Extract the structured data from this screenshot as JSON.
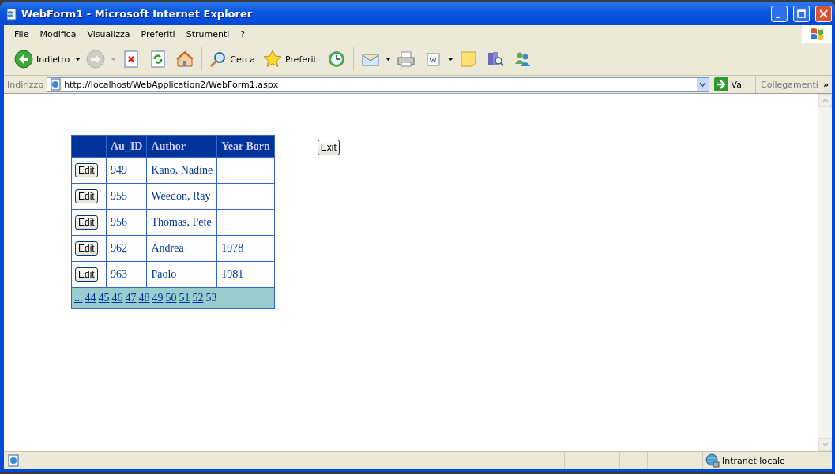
{
  "window": {
    "title": "WebForm1 - Microsoft Internet Explorer"
  },
  "menu": [
    "File",
    "Modifica",
    "Visualizza",
    "Preferiti",
    "Strumenti",
    "?"
  ],
  "toolbar": {
    "back": "Indietro",
    "forward_disabled": true,
    "search": "Cerca",
    "favorites": "Preferiti"
  },
  "address": {
    "label": "Indirizzo",
    "value": "http://localhost/WebApplication2/WebForm1.aspx",
    "go": "Vai",
    "links": "Collegamenti",
    "more": "»"
  },
  "grid": {
    "columns": [
      "Au_ID",
      "Author",
      "Year Born"
    ],
    "rows": [
      {
        "action": "Edit",
        "au_id": "949",
        "author": "Kano, Nadine"
      },
      {
        "action": "Edit",
        "au_id": "955",
        "author": "Weedon, Ray"
      },
      {
        "action": "Edit",
        "au_id": "956",
        "author": "Thomas, Pete"
      },
      {
        "action": "Edit",
        "au_id": "962",
        "author": "Andrea",
        "year_born": "1978"
      },
      {
        "action": "Edit",
        "au_id": "963",
        "author": "Paolo",
        "year_born": "1981"
      }
    ],
    "pager": [
      {
        "label": "...",
        "selected": false
      },
      {
        "label": "44",
        "selected": false
      },
      {
        "label": "45",
        "selected": false
      },
      {
        "label": "46",
        "selected": false
      },
      {
        "label": "47",
        "selected": false
      },
      {
        "label": "48",
        "selected": false
      },
      {
        "label": "49",
        "selected": false
      },
      {
        "label": "50",
        "selected": false
      },
      {
        "label": "51",
        "selected": false
      },
      {
        "label": "52",
        "selected": false
      },
      {
        "label": "53",
        "selected": true
      }
    ]
  },
  "exit_button": "Exit",
  "status_bar": {
    "zone": "Intranet locale"
  }
}
